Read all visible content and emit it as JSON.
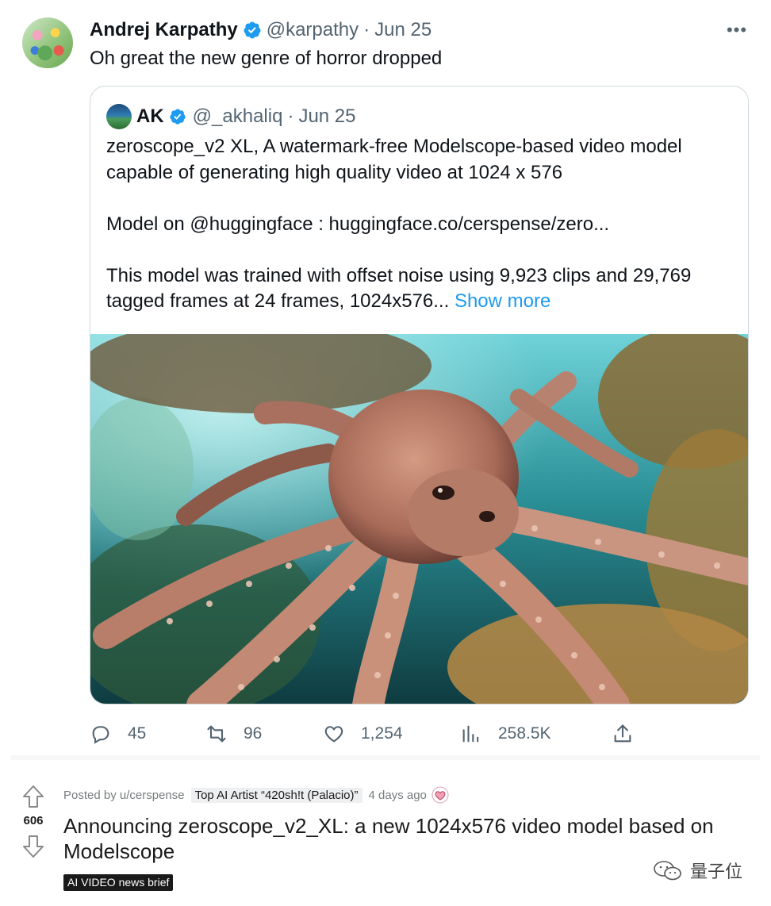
{
  "tweet": {
    "author_name": "Andrej Karpathy",
    "author_handle": "@karpathy",
    "separator": "·",
    "date": "Jun 25",
    "more_glyph": "•••",
    "text": "Oh great the new genre of horror dropped",
    "quoted": {
      "author_name": "AK",
      "author_handle": "@_akhaliq",
      "separator": "·",
      "date": "Jun 25",
      "line1": "zeroscope_v2 XL, A watermark-free Modelscope-based video model",
      "line2": "capable of generating high quality video at 1024 x 576",
      "line3": "Model on @huggingface : huggingface.co/cerspense/zero...",
      "line4": "This model was trained with offset noise using 9,923 clips and 29,769",
      "line5": "tagged frames at 24 frames, 1024x576...",
      "show_more": "Show more"
    },
    "actions": {
      "replies": "45",
      "retweets": "96",
      "likes": "1,254",
      "views": "258.5K"
    },
    "colors": {
      "verified": "#1d9bf0",
      "link": "#1d9bf0",
      "secondary": "#536471"
    }
  },
  "reddit": {
    "score": "606",
    "posted_by": "Posted by u/cerspense",
    "user_flair": "Top AI Artist “420sh!t (Palacio)”",
    "time_ago": "4 days ago",
    "title": "Announcing zeroscope_v2_XL: a new 1024x576 video model based on Modelscope",
    "post_flair": "AI VIDEO news brief"
  },
  "watermark": {
    "text": "量子位"
  }
}
